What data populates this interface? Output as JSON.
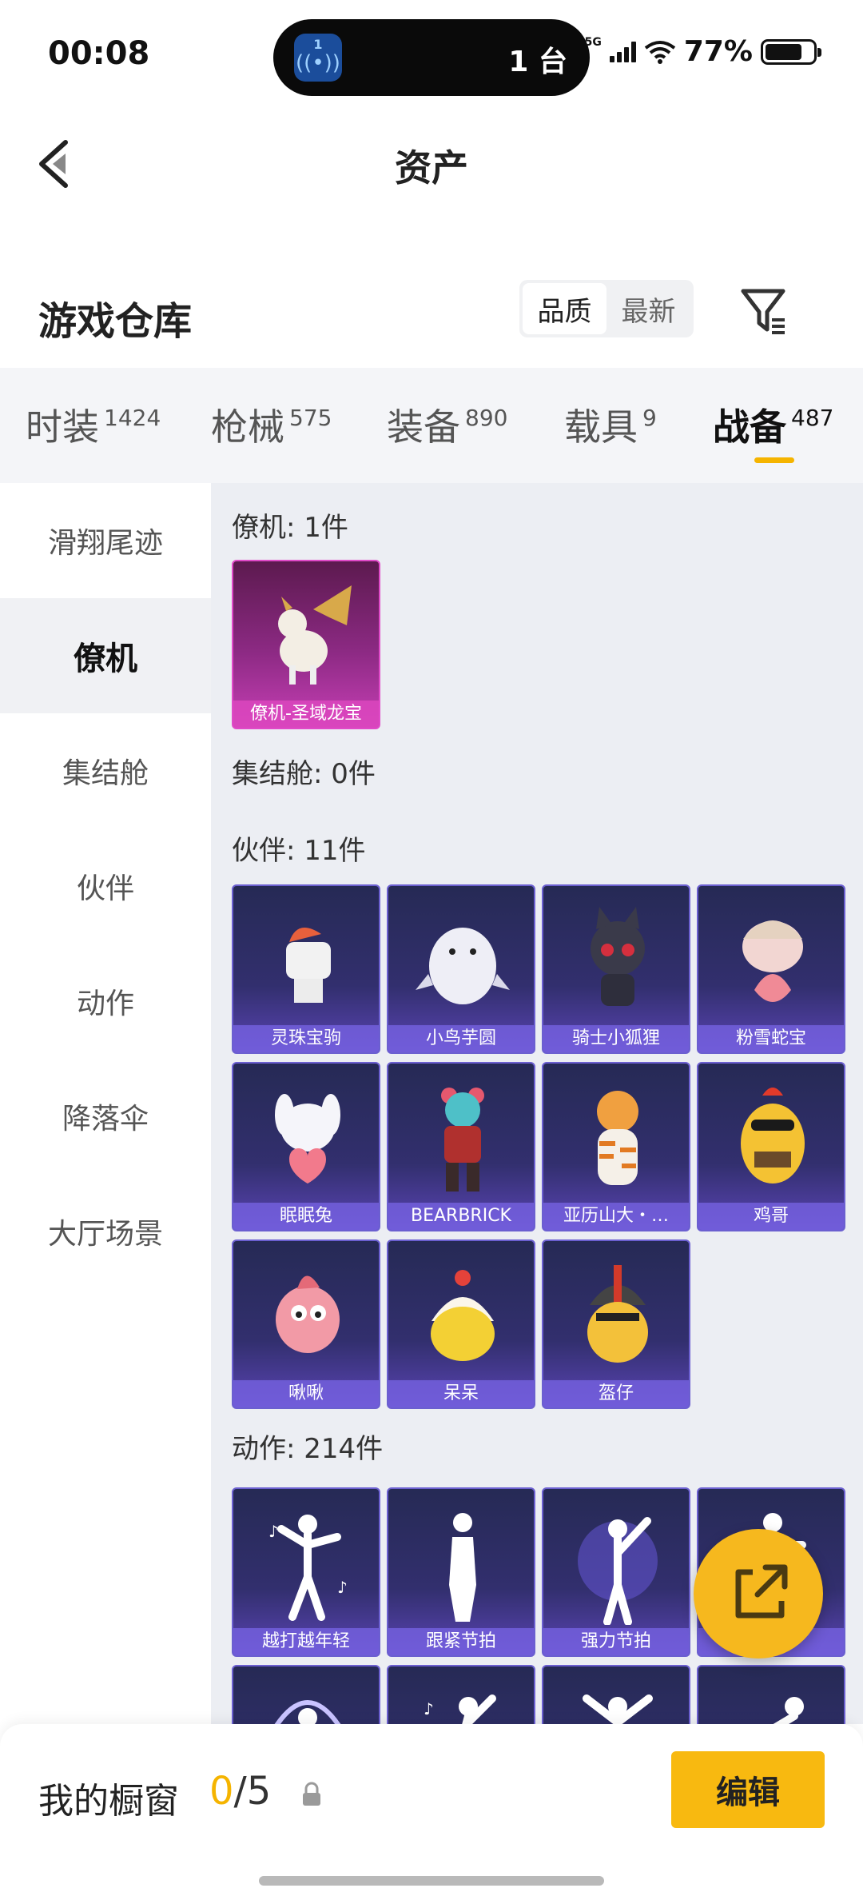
{
  "status": {
    "time": "00:08",
    "island_count": "1",
    "island_text": "1 台",
    "network": "5G",
    "battery": "77%"
  },
  "header": {
    "title": "资产"
  },
  "warehouse": {
    "title": "游戏仓库",
    "sort_options": [
      "品质",
      "最新"
    ],
    "active_sort": "品质"
  },
  "tabs": [
    {
      "label": "时装",
      "count": "1424"
    },
    {
      "label": "枪械",
      "count": "575"
    },
    {
      "label": "装备",
      "count": "890"
    },
    {
      "label": "载具",
      "count": "9"
    },
    {
      "label": "战备",
      "count": "487"
    }
  ],
  "active_tab": "战备",
  "sidebar": [
    "滑翔尾迹",
    "僚机",
    "集结舱",
    "伙伴",
    "动作",
    "降落伞",
    "大厅场景"
  ],
  "active_sidebar": "僚机",
  "sections": {
    "wingman": {
      "label": "僚机: 1件",
      "items": [
        "僚机-圣域龙宝"
      ]
    },
    "pod": {
      "label": "集结舱: 0件"
    },
    "partner": {
      "label": "伙伴: 11件",
      "items": [
        "灵珠宝驹",
        "小鸟芋圆",
        "骑士小狐狸",
        "粉雪蛇宝",
        "眠眠兔",
        "BEARBRICK",
        "亚历山大・…",
        "鸡哥",
        "啾啾",
        "呆呆",
        "盔仔"
      ]
    },
    "emote": {
      "label": "动作: 214件",
      "items": [
        "越打越年轻",
        "跟紧节拍",
        "强力节拍",
        ""
      ]
    }
  },
  "bottom": {
    "showcase_label": "我的橱窗",
    "showcase_current": "0",
    "showcase_total": "/5",
    "edit_label": "编辑"
  },
  "colors": {
    "accent": "#f5b400",
    "card_purple": "#322f6e",
    "card_pink": "#c73fb5"
  },
  "icons": {
    "back": "chevron-left-icon",
    "filter": "filter-icon",
    "share": "share-icon",
    "lock": "lock-icon"
  }
}
